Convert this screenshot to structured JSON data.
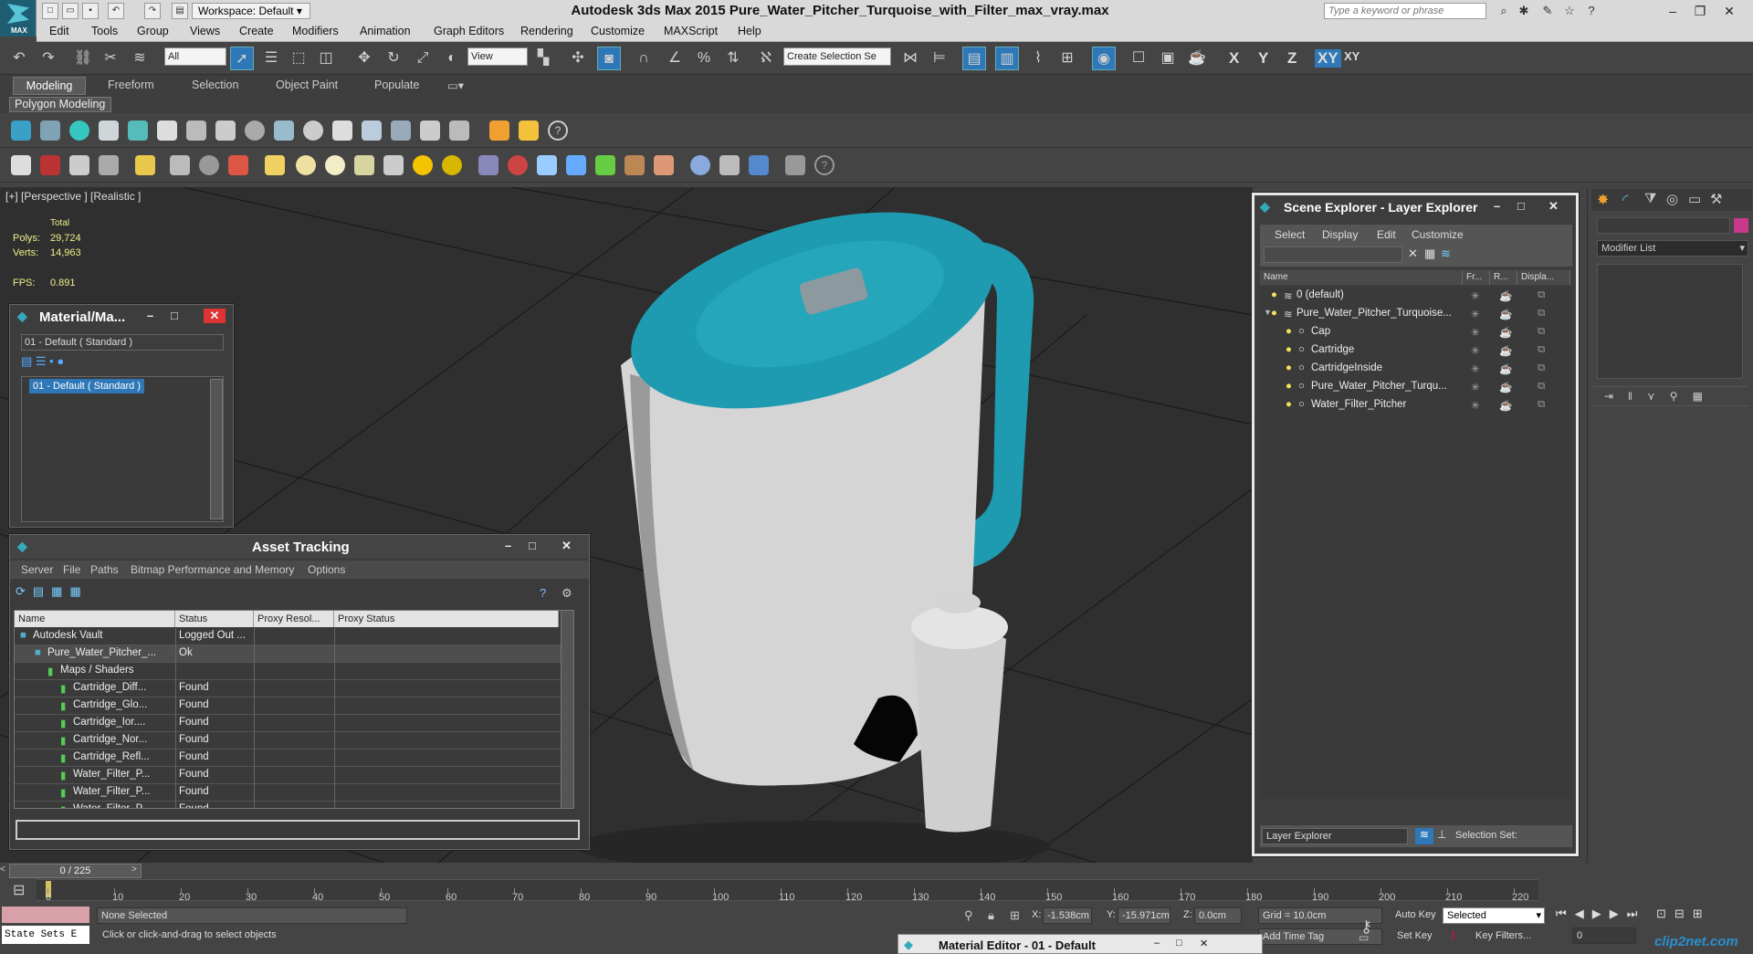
{
  "app": {
    "title": "Autodesk 3ds Max  2015    Pure_Water_Pitcher_Turquoise_with_Filter_max_vray.max",
    "workspace": "Workspace: Default",
    "search_placeholder": "Type a keyword or phrase",
    "logo_text": "MAX"
  },
  "menu": [
    "Edit",
    "Tools",
    "Group",
    "Views",
    "Create",
    "Modifiers",
    "Animation",
    "Graph Editors",
    "Rendering",
    "Customize",
    "MAXScript",
    "Help"
  ],
  "toolbar": {
    "filter": "All",
    "refcoord": "View",
    "selset": "Create Selection Se",
    "axes": [
      "X",
      "Y",
      "Z",
      "XY",
      "XY"
    ]
  },
  "ribbon": {
    "tabs": [
      "Modeling",
      "Freeform",
      "Selection",
      "Object Paint",
      "Populate"
    ],
    "sub": "Polygon Modeling"
  },
  "viewport": {
    "label": "[+] [Perspective ] [Realistic ]",
    "total": "Total",
    "polys_label": "Polys:",
    "polys": "29,724",
    "verts_label": "Verts:",
    "verts": "14,963",
    "fps_label": "FPS:",
    "fps": "0.891"
  },
  "material_mini": {
    "title": "Material/Ma...",
    "field": "01 - Default  ( Standard )",
    "item": "01 - Default  ( Standard )"
  },
  "asset": {
    "title": "Asset Tracking",
    "menu": [
      "Server",
      "File",
      "Paths",
      "Bitmap Performance and Memory",
      "Options"
    ],
    "columns": [
      "Name",
      "Status",
      "Proxy Resol...",
      "Proxy Status"
    ],
    "rows": [
      [
        "Autodesk Vault",
        "Logged Out ..."
      ],
      [
        "Pure_Water_Pitcher_...",
        "Ok"
      ],
      [
        "Maps / Shaders",
        ""
      ],
      [
        "Cartridge_Diff...",
        "Found"
      ],
      [
        "Cartridge_Glo...",
        "Found"
      ],
      [
        "Cartridge_Ior....",
        "Found"
      ],
      [
        "Cartridge_Nor...",
        "Found"
      ],
      [
        "Cartridge_Refl...",
        "Found"
      ],
      [
        "Water_Filter_P...",
        "Found"
      ],
      [
        "Water_Filter_P...",
        "Found"
      ],
      [
        "Water_Filter_P...",
        "Found"
      ]
    ]
  },
  "scene": {
    "title": "Scene Explorer - Layer Explorer",
    "menu": [
      "Select",
      "Display",
      "Edit",
      "Customize"
    ],
    "columns": [
      "Name",
      "Fr...",
      "R...",
      "Displa..."
    ],
    "rows": [
      "0 (default)",
      "Pure_Water_Pitcher_Turquoise...",
      "Cap",
      "Cartridge",
      "CartridgeInside",
      "Pure_Water_Pitcher_Turqu...",
      "Water_Filter_Pitcher"
    ],
    "footer_left": "Layer Explorer",
    "footer_right": "Selection Set:"
  },
  "command": {
    "modifier_list": "Modifier List"
  },
  "timeline": {
    "frame": "0 / 225",
    "ticks": [
      "0",
      "10",
      "20",
      "30",
      "40",
      "50",
      "60",
      "70",
      "80",
      "90",
      "100",
      "110",
      "120",
      "130",
      "140",
      "150",
      "160",
      "170",
      "180",
      "190",
      "200",
      "210",
      "220"
    ]
  },
  "status": {
    "state_sets": "State Sets E",
    "selected": "None Selected",
    "hint": "Click or click-and-drag to select objects",
    "x_label": "X:",
    "x": "-1.538cm",
    "y_label": "Y:",
    "y": "-15.971cm",
    "z_label": "Z:",
    "z": "0.0cm",
    "grid": "Grid = 10.0cm",
    "auto_key": "Auto Key",
    "auto_key_val": "Selected",
    "set_key": "Set Key",
    "key_filters": "Key Filters...",
    "add_time_tag": "Add Time Tag",
    "frame_field": "0",
    "mat_editor": "Material Editor - 01 - Default",
    "watermark": "clip2net.com"
  },
  "colors": {
    "accent": "#2e78b7",
    "teal": "#1e9bb0",
    "viewport_bg": "#2f2f2f"
  }
}
